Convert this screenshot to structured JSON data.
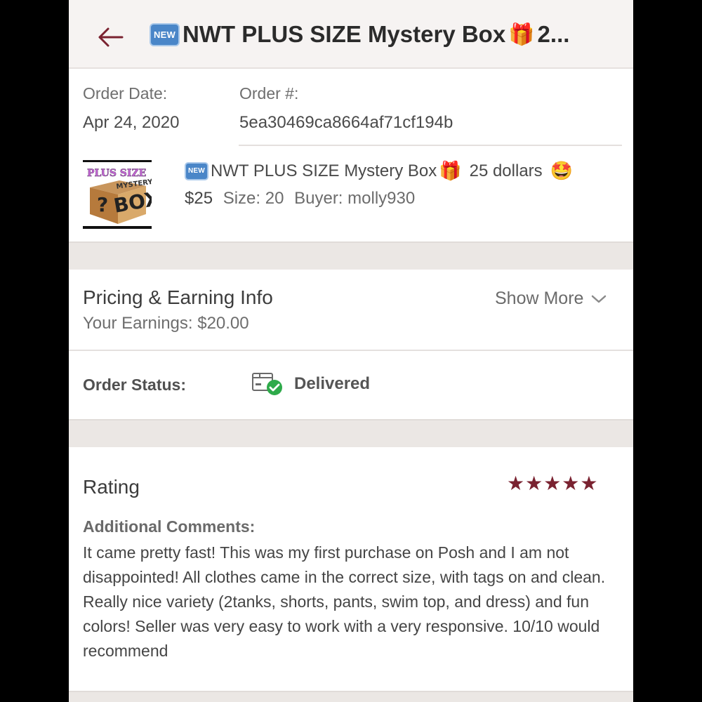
{
  "header": {
    "badge": "NEW",
    "title": "NWT PLUS SIZE Mystery Box",
    "gift": "🎁",
    "title_suffix": "2..."
  },
  "order": {
    "date_label": "Order Date:",
    "date_value": "Apr 24, 2020",
    "number_label": "Order #:",
    "number_value": "5ea30469ca8664af71cf194b"
  },
  "item": {
    "thumb_line1": "PLUS SIZE",
    "thumb_line2": "MYSTERY",
    "thumb_line3": "BOX",
    "thumb_q": "?",
    "badge": "NEW",
    "title": "NWT PLUS SIZE Mystery Box",
    "gift": "🎁",
    "title_suffix": "25 dollars",
    "emoji": "🤩",
    "price": "$25",
    "size": "Size: 20",
    "buyer": "Buyer: molly930"
  },
  "pricing": {
    "title": "Pricing & Earning Info",
    "earnings": "Your Earnings: $20.00",
    "show_more": "Show More"
  },
  "status": {
    "label": "Order Status:",
    "value": "Delivered",
    "icon": "package-delivered-icon"
  },
  "rating": {
    "title": "Rating",
    "stars": 5,
    "stars_text": "★★★★★",
    "star_color": "#7a2230",
    "comments_label": "Additional Comments:",
    "comments": "It came pretty fast! This was my first purchase on Posh and I am not disappointed! All clothes came in the correct size, with tags on and clean. Really nice variety (2tanks, shorts, pants, swim top, and dress) and fun colors! Seller was very easy to work with a very responsive. 10/10 would recommend"
  },
  "colors": {
    "accent": "#7a2230",
    "new_badge": "#4a86c8",
    "delivered_check": "#2eaa4a"
  }
}
